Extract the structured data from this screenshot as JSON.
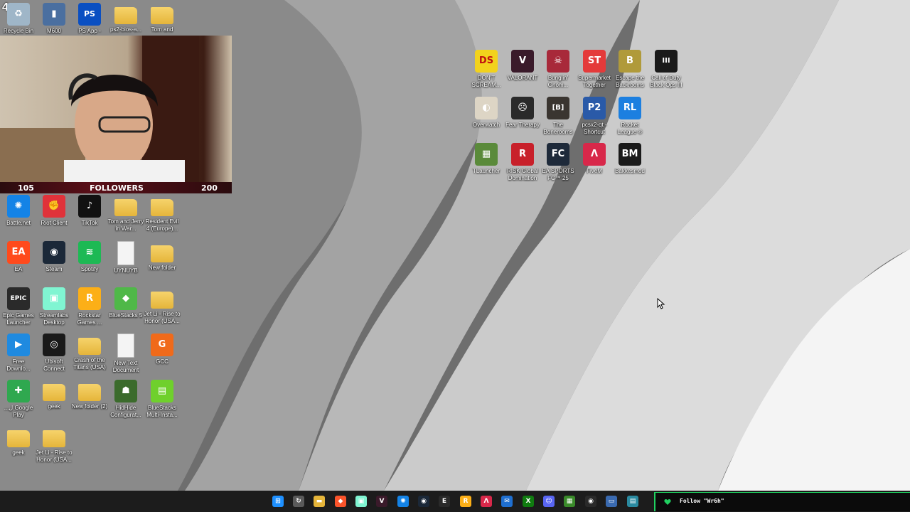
{
  "desktop": {
    "corner_number": "4",
    "left_icons": [
      {
        "label": "Recycle Bin",
        "icon": "recycle-bin-icon",
        "color": "#9fb6c8",
        "glyph": "♻"
      },
      {
        "label": "M600",
        "icon": "mouse-icon",
        "color": "#4a6fa0",
        "glyph": "▮"
      },
      {
        "label": "PS App -",
        "icon": "playstation-icon",
        "color": "#0a4fc2",
        "glyph": "PS"
      },
      {
        "label": "ps2-bios-a...",
        "icon": "folder-icon",
        "color": "#e5b53a",
        "glyph": ""
      },
      {
        "label": "Tom and",
        "icon": "folder-icon",
        "color": "#e5b53a",
        "glyph": ""
      },
      {
        "label": "Battle.net",
        "icon": "battlenet-icon",
        "color": "#1483e6",
        "glyph": "✺"
      },
      {
        "label": "Riot Client",
        "icon": "riot-client-icon",
        "color": "#e0323a",
        "glyph": "✊"
      },
      {
        "label": "TikTok",
        "icon": "tiktok-icon",
        "color": "#111111",
        "glyph": "♪"
      },
      {
        "label": "Tom and Jerry in War...",
        "icon": "folder-icon",
        "color": "#e5b53a",
        "glyph": ""
      },
      {
        "label": "Resident Evil 4 (Europe)...",
        "icon": "folder-icon",
        "color": "#e5b53a",
        "glyph": ""
      },
      {
        "label": "EA",
        "icon": "ea-icon",
        "color": "#ff4a1c",
        "glyph": "EA"
      },
      {
        "label": "Steam",
        "icon": "steam-icon",
        "color": "#1b2838",
        "glyph": "◉"
      },
      {
        "label": "Spotify",
        "icon": "spotify-icon",
        "color": "#1db954",
        "glyph": "≋"
      },
      {
        "label": "UYNUYB",
        "icon": "text-document-icon",
        "color": "#f4f4f4",
        "glyph": ""
      },
      {
        "label": "New folder",
        "icon": "folder-icon",
        "color": "#e5b53a",
        "glyph": ""
      },
      {
        "label": "Epic Games Launcher",
        "icon": "epic-games-icon",
        "color": "#2a2a2a",
        "glyph": "EPIC"
      },
      {
        "label": "Streamlabs Desktop",
        "icon": "streamlabs-icon",
        "color": "#80f5d2",
        "glyph": "▣"
      },
      {
        "label": "Rockstar Games ...",
        "icon": "rockstar-icon",
        "color": "#fcaf17",
        "glyph": "R"
      },
      {
        "label": "BlueStacks 5",
        "icon": "bluestacks-icon",
        "color": "#4fb848",
        "glyph": "◆"
      },
      {
        "label": "Jet Li - Rise to Honor (USA...",
        "icon": "folder-icon",
        "color": "#e5b53a",
        "glyph": ""
      },
      {
        "label": "Free Downlo...",
        "icon": "free-download-manager-icon",
        "color": "#1f8ae0",
        "glyph": "▶"
      },
      {
        "label": "Ubisoft Connect",
        "icon": "ubisoft-icon",
        "color": "#1a1a1a",
        "glyph": "◎"
      },
      {
        "label": "Crash of the Titans (USA)",
        "icon": "folder-icon",
        "color": "#e5b53a",
        "glyph": ""
      },
      {
        "label": "New Text Document",
        "icon": "text-document-icon",
        "color": "#f4f4f4",
        "glyph": ""
      },
      {
        "label": "GCC",
        "icon": "gcc-icon",
        "color": "#f06a1a",
        "glyph": "G"
      },
      {
        "label": "...ل Google Play",
        "icon": "google-play-games-icon",
        "color": "#2fa84f",
        "glyph": "✚"
      },
      {
        "label": "geek",
        "icon": "folder-icon",
        "color": "#e5b53a",
        "glyph": ""
      },
      {
        "label": "New folder (2)",
        "icon": "folder-icon",
        "color": "#e5b53a",
        "glyph": ""
      },
      {
        "label": "HidHide Configurat...",
        "icon": "hidhide-icon",
        "color": "#3b6b2c",
        "glyph": "☗"
      },
      {
        "label": "BlueStacks Multi-Insta...",
        "icon": "bluestacks-multi-instance-icon",
        "color": "#6fd02c",
        "glyph": "▤"
      },
      {
        "label": "geek",
        "icon": "folder-icon",
        "color": "#e5b53a",
        "glyph": ""
      },
      {
        "label": "Jet Li - Rise to Honor (USA...",
        "icon": "folder-icon",
        "color": "#e5b53a",
        "glyph": ""
      }
    ],
    "game_icons": [
      {
        "label": "DON'T SCREAM...",
        "icon": "dont-scream-icon",
        "color": "#f2d21c",
        "glyph": "DS"
      },
      {
        "label": "VALORANT",
        "icon": "valorant-icon",
        "color": "#3a1a2a",
        "glyph": "V"
      },
      {
        "label": "Bunglin' Gnom...",
        "icon": "bunglin-gnome-icon",
        "color": "#a8293a",
        "glyph": "☠"
      },
      {
        "label": "Supermarket Together",
        "icon": "supermarket-together-icon",
        "color": "#e43a3a",
        "glyph": "ST"
      },
      {
        "label": "Escape the Backrooms",
        "icon": "escape-backrooms-icon",
        "color": "#b09a3a",
        "glyph": "B"
      },
      {
        "label": "Call of Duty Black Ops III",
        "icon": "call-of-duty-icon",
        "color": "#1a1a1a",
        "glyph": "III"
      },
      {
        "label": "Overwatch",
        "icon": "overwatch-icon",
        "color": "#ddd5c5",
        "glyph": "◐"
      },
      {
        "label": "Fear Therapy",
        "icon": "fear-therapy-icon",
        "color": "#2a2a2a",
        "glyph": "☹"
      },
      {
        "label": "The Bonerooms",
        "icon": "bonerooms-icon",
        "color": "#3a3530",
        "glyph": "[B]"
      },
      {
        "label": "pcsx2-qt - Shortcut",
        "icon": "pcsx2-icon",
        "color": "#2a5aa8",
        "glyph": "P2"
      },
      {
        "label": "Rocket League ®",
        "icon": "rocket-league-icon",
        "color": "#1c7fe0",
        "glyph": "RL"
      },
      {
        "label": "TLauncher",
        "icon": "tlauncher-icon",
        "color": "#5a8a3a",
        "glyph": "▦"
      },
      {
        "label": "RISK Global Domination",
        "icon": "risk-icon",
        "color": "#c8202a",
        "glyph": "R"
      },
      {
        "label": "EA SPORTS FC™ 25",
        "icon": "ea-sports-fc-icon",
        "color": "#1e2a3a",
        "glyph": "FC"
      },
      {
        "label": "FiveM",
        "icon": "fivem-icon",
        "color": "#d8284a",
        "glyph": "Λ"
      },
      {
        "label": "Bakkesmod",
        "icon": "bakkesmod-icon",
        "color": "#1a1a1a",
        "glyph": "BM"
      }
    ]
  },
  "webcam": {
    "followers_left": "105",
    "followers_title": "FOLLOWERS",
    "followers_right": "200",
    "followers_progress": 0
  },
  "taskbar": {
    "icons": [
      {
        "name": "start-icon",
        "color": "#1e90ff",
        "glyph": "⊞"
      },
      {
        "name": "refresh-icon",
        "color": "#5a5a5a",
        "glyph": "↻"
      },
      {
        "name": "file-explorer-icon",
        "color": "#e5b53a",
        "glyph": "▬"
      },
      {
        "name": "brave-browser-icon",
        "color": "#fb542b",
        "glyph": "◆"
      },
      {
        "name": "streamlabs-icon",
        "color": "#80f5d2",
        "glyph": "▣"
      },
      {
        "name": "valorant-icon",
        "color": "#3a1a2a",
        "glyph": "V"
      },
      {
        "name": "battlenet-icon",
        "color": "#1483e6",
        "glyph": "✺"
      },
      {
        "name": "steam-icon",
        "color": "#1b2838",
        "glyph": "◉"
      },
      {
        "name": "epic-games-icon",
        "color": "#2a2a2a",
        "glyph": "E"
      },
      {
        "name": "rockstar-icon",
        "color": "#fcaf17",
        "glyph": "R"
      },
      {
        "name": "fivem-icon",
        "color": "#d8284a",
        "glyph": "Λ"
      },
      {
        "name": "outlook-icon",
        "color": "#1f6fd0",
        "glyph": "✉"
      },
      {
        "name": "xbox-icon",
        "color": "#107c10",
        "glyph": "X"
      },
      {
        "name": "discord-icon",
        "color": "#5865f2",
        "glyph": "☺"
      },
      {
        "name": "minecraft-icon",
        "color": "#3a8a2a",
        "glyph": "▦"
      },
      {
        "name": "obs-icon",
        "color": "#2a2a2a",
        "glyph": "◉"
      },
      {
        "name": "window-icon",
        "color": "#3a6ab0",
        "glyph": "▭"
      },
      {
        "name": "terminal-icon",
        "color": "#2a8aa0",
        "glyph": "▤"
      }
    ]
  },
  "follow_alert": {
    "text": "Follow \"Wr6h\"",
    "accent": "#20d060"
  }
}
